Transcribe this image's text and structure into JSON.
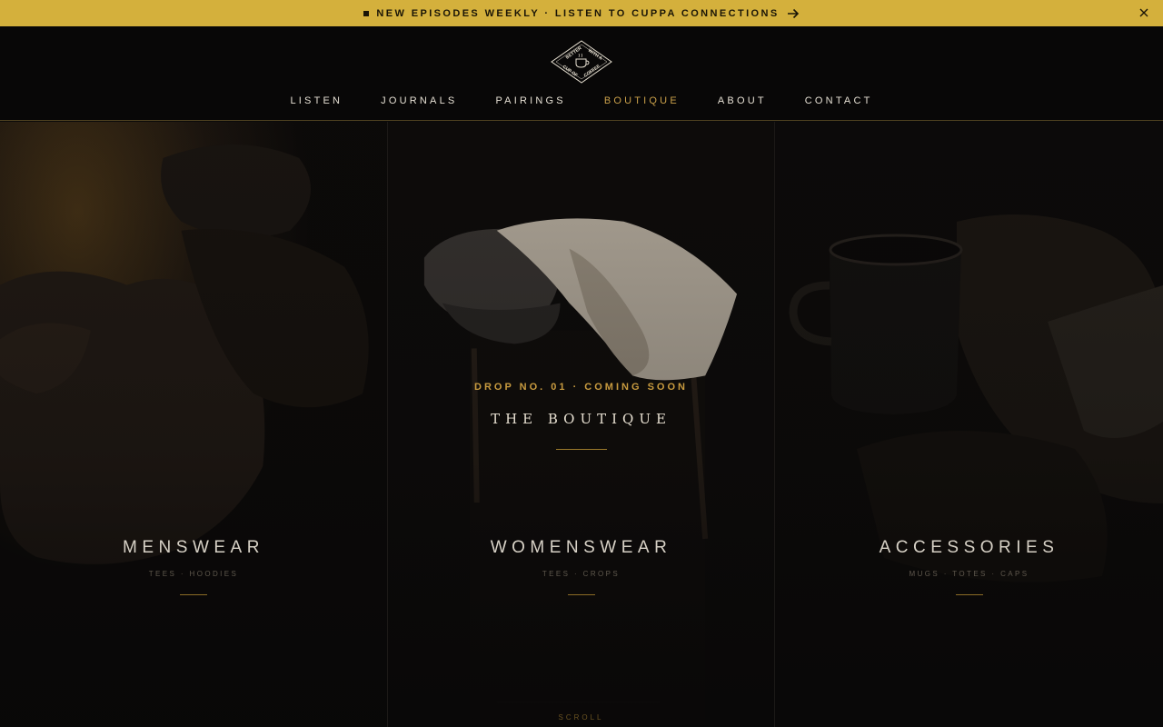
{
  "announcement": {
    "text": "NEW EPISODES WEEKLY · LISTEN TO CUPPA CONNECTIONS",
    "icons": [
      "square-bullet-icon",
      "arrow-right-icon",
      "close-icon"
    ]
  },
  "logo": {
    "text_top_left": "BETTER",
    "text_top_right": "WITH A",
    "text_bottom_left": "CUP OF",
    "text_bottom_right": "COFFEE",
    "icon": "coffee-cup-icon"
  },
  "nav": {
    "items": [
      {
        "label": "LISTEN"
      },
      {
        "label": "JOURNALS"
      },
      {
        "label": "PAIRINGS"
      },
      {
        "label": "BOUTIQUE",
        "active": true
      },
      {
        "label": "ABOUT"
      },
      {
        "label": "CONTACT"
      }
    ]
  },
  "hero": {
    "drop_tag": "DROP NO. 01 · COMING SOON",
    "title": "THE BOUTIQUE",
    "scroll_label": "SCROLL"
  },
  "panels": [
    {
      "title": "MENSWEAR",
      "subtitle": "TEES · HOODIES"
    },
    {
      "title": "WOMENSWEAR",
      "subtitle": "TEES · CROPS"
    },
    {
      "title": "ACCESSORIES",
      "subtitle": "MUGS · TOTES · CAPS"
    }
  ],
  "colors": {
    "announce_bg": "#d4b03c",
    "accent_gold": "#caa04a",
    "page_bg": "#0b0a0a"
  }
}
